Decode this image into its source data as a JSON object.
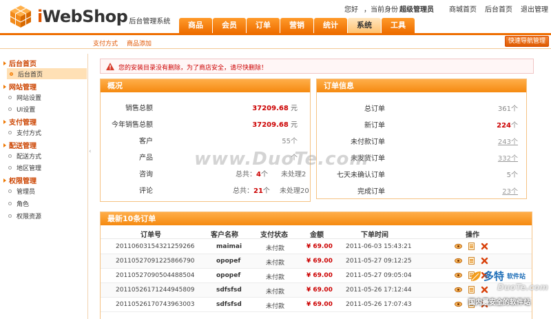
{
  "header": {
    "logo_text_i": "i",
    "logo_text_rest": "WebShop",
    "logo_sub": "后台管理系统",
    "greeting": "您好",
    "identity": "，当前身份",
    "role": "超级管理员",
    "links": [
      "商城首页",
      "后台首页",
      "退出管理"
    ]
  },
  "nav": {
    "tabs": [
      "商品",
      "会员",
      "订单",
      "营销",
      "统计",
      "系统",
      "工具"
    ],
    "active": "系统"
  },
  "subnav": {
    "items": [
      "支付方式",
      "商品添加"
    ],
    "quick_button": "快速导航管理"
  },
  "sidebar": {
    "groups": [
      {
        "title": "后台首页",
        "items": [
          "后台首页"
        ]
      },
      {
        "title": "网站管理",
        "items": [
          "网站设置",
          "UI设置"
        ]
      },
      {
        "title": "支付管理",
        "items": [
          "支付方式"
        ]
      },
      {
        "title": "配送管理",
        "items": [
          "配送方式",
          "地区管理"
        ]
      },
      {
        "title": "权限管理",
        "items": [
          "管理员",
          "角色",
          "权限资源"
        ]
      }
    ],
    "active_item": "后台首页"
  },
  "alert": {
    "text": "您的安装目录没有删除，为了商店安全，请尽快删除！"
  },
  "overview": {
    "title": "概况",
    "rows": [
      {
        "label": "销售总额",
        "value": "37209.68",
        "unit": "元"
      },
      {
        "label": "今年销售总额",
        "value": "37209.68",
        "unit": "元"
      },
      {
        "label": "客户",
        "value": "55",
        "unit": "个"
      },
      {
        "label": "产品",
        "value": "",
        "unit": "个"
      },
      {
        "label": "咨询",
        "total_label": "总共：",
        "total": "4",
        "total_unit": "个",
        "pending": "未处理2"
      },
      {
        "label": "评论",
        "total_label": "总共：",
        "total": "21",
        "total_unit": "个",
        "pending": "未处理20"
      }
    ]
  },
  "order_info": {
    "title": "订单信息",
    "rows": [
      {
        "label": "总订单",
        "value": "361",
        "unit": "个"
      },
      {
        "label": "新订单",
        "value": "224",
        "unit": "个"
      },
      {
        "label": "未付款订单",
        "value": "243",
        "unit": "个"
      },
      {
        "label": "未发货订单",
        "value": "332",
        "unit": "个"
      },
      {
        "label": "七天未确认订单",
        "value": "5",
        "unit": "个"
      },
      {
        "label": "完成订单",
        "value": "23",
        "unit": "个"
      }
    ]
  },
  "latest_orders": {
    "title_prefix": "最新",
    "title_count": "10",
    "title_suffix": "条订单",
    "columns": [
      "订单号",
      "客户名称",
      "支付状态",
      "金额",
      "下单时间",
      "操作"
    ],
    "rows": [
      {
        "id": "20110603154321259266",
        "name": "maimai",
        "status": "未付款",
        "amount": "¥ 69.00",
        "time": "2011-06-03 15:43:21"
      },
      {
        "id": "20110527091225866790",
        "name": "opopef",
        "status": "未付款",
        "amount": "¥ 69.00",
        "time": "2011-05-27 09:12:25"
      },
      {
        "id": "20110527090504488504",
        "name": "opopef",
        "status": "未付款",
        "amount": "¥ 69.00",
        "time": "2011-05-27 09:05:04"
      },
      {
        "id": "20110526171244945809",
        "name": "sdfsfsd",
        "status": "未付款",
        "amount": "¥ 69.00",
        "time": "2011-05-26 17:12:44"
      },
      {
        "id": "20110526170743963003",
        "name": "sdfsfsd",
        "status": "未付款",
        "amount": "¥ 69.00",
        "time": "2011-05-26 17:07:43"
      }
    ],
    "ops_icons": [
      "view-icon",
      "edit-icon",
      "delete-icon"
    ]
  },
  "watermarks": {
    "center": "www.DuoTe.com",
    "corner_brand": "多特",
    "corner_small": "软件站",
    "corner_site": "DuoTe.com",
    "corner_slogan": "国内最安全的软件站"
  },
  "colors": {
    "accent": "#ee6e00",
    "panel_head": "#f58a10",
    "alert_text": "#cc0000",
    "value_red": "#cc0000"
  }
}
